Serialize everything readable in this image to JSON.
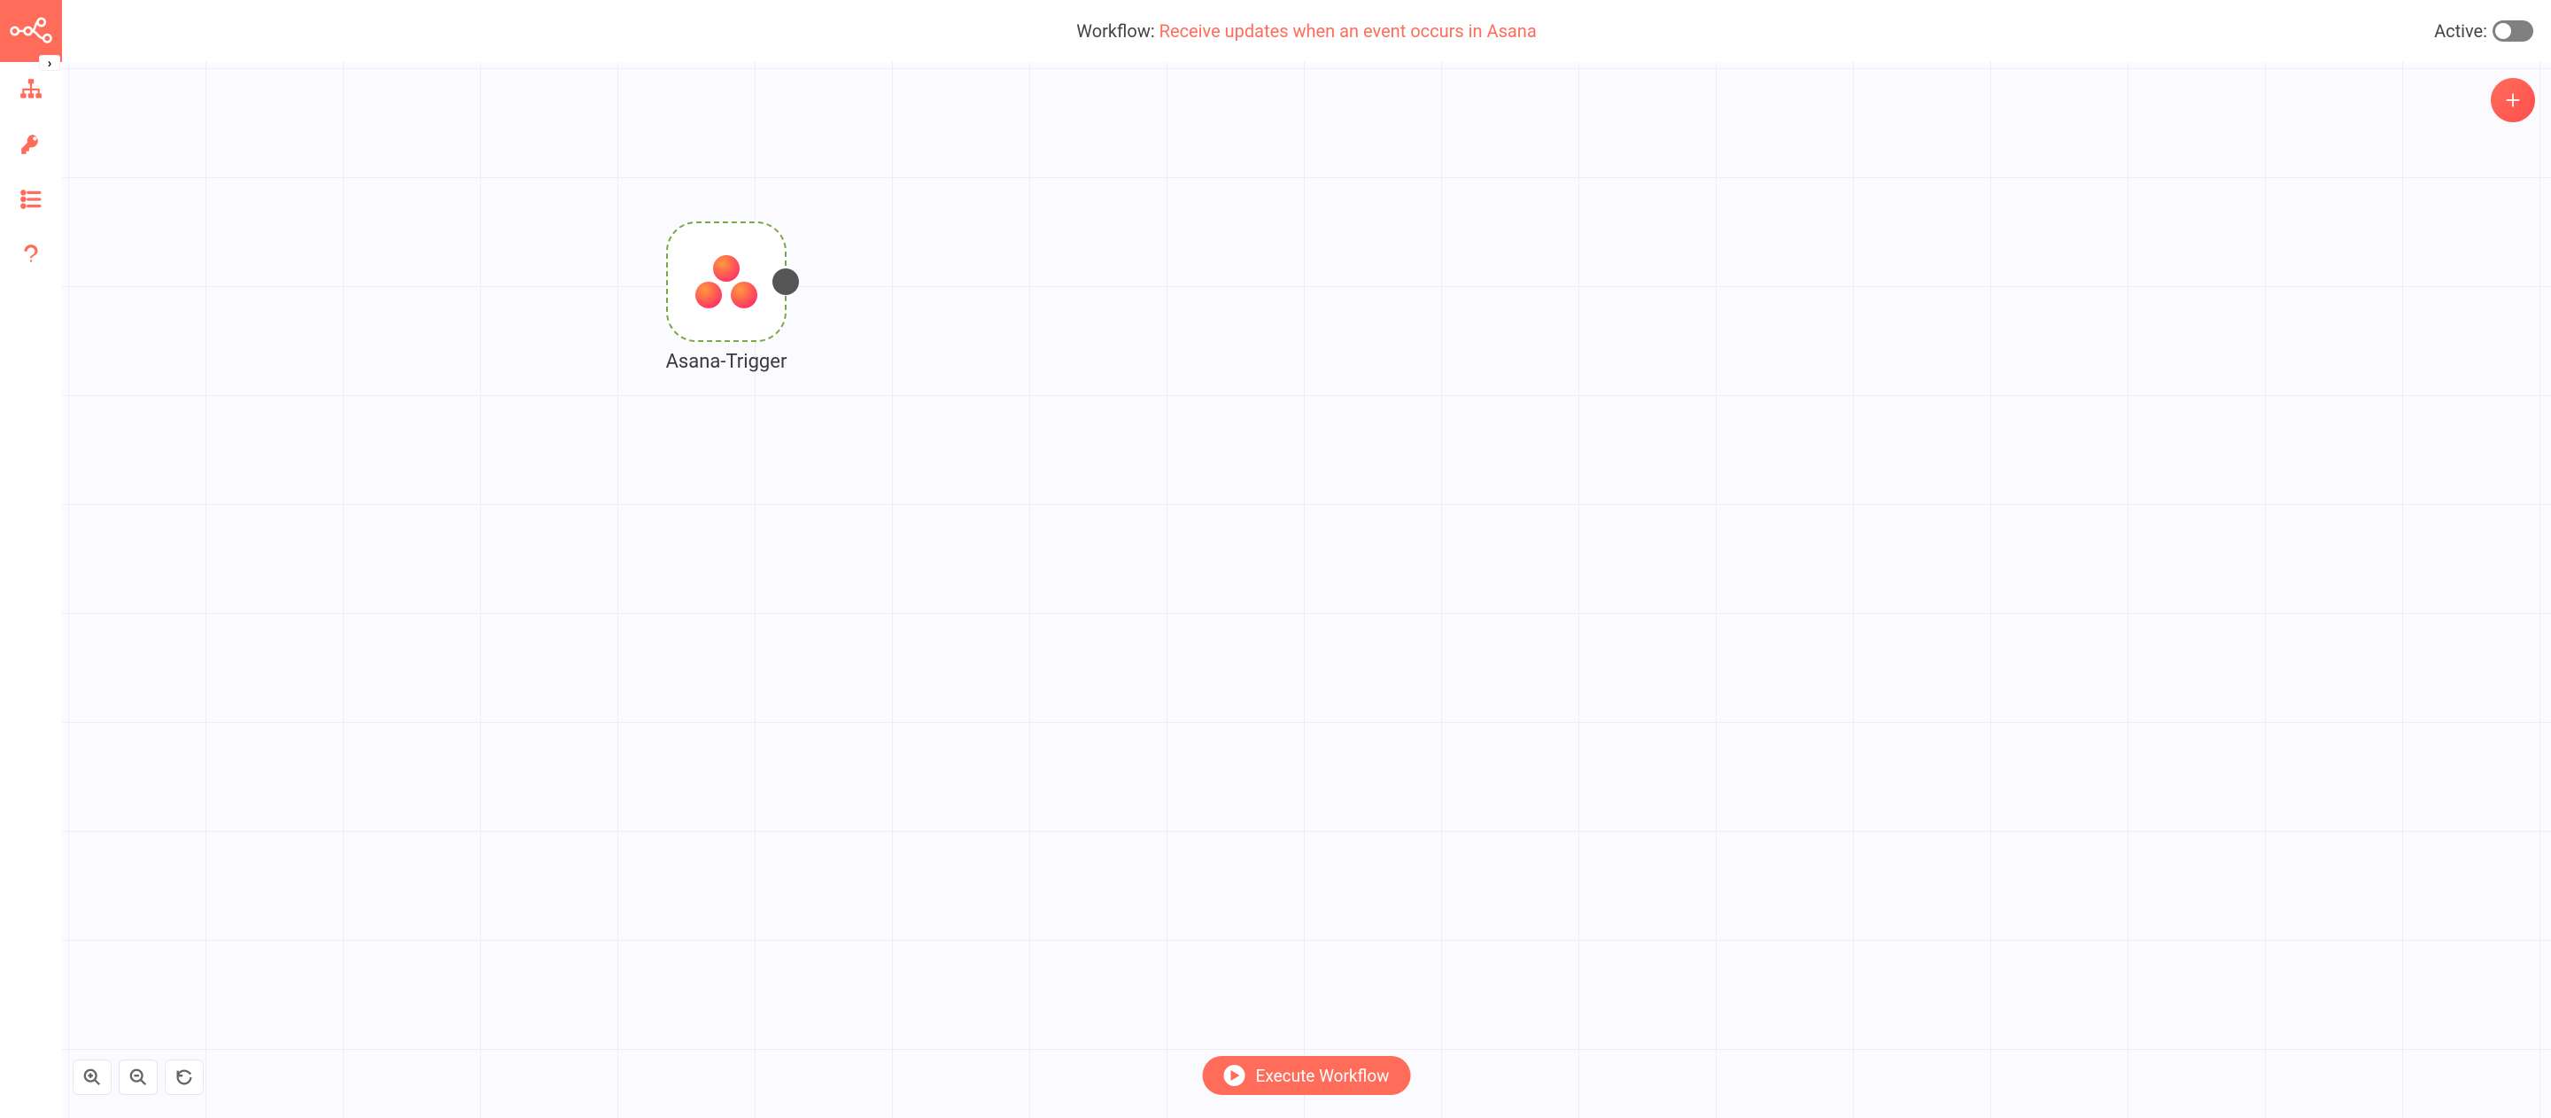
{
  "colors": {
    "accent": "#ff6d5a",
    "node_border": "#7aa845",
    "canvas_bg": "#fafaff"
  },
  "sidebar": {
    "logo_icon": "n8n-logo-icon",
    "expand_icon": "chevron-right-icon",
    "items": [
      {
        "name": "workflows",
        "icon": "sitemap-icon"
      },
      {
        "name": "credentials",
        "icon": "key-icon"
      },
      {
        "name": "executions",
        "icon": "list-icon"
      },
      {
        "name": "help",
        "icon": "question-icon"
      }
    ]
  },
  "header": {
    "prefix": "Workflow: ",
    "workflow_name": "Receive updates when an event occurs in Asana",
    "active_label": "Active:",
    "active_state": false
  },
  "canvas": {
    "add_node_icon": "plus-icon",
    "node": {
      "label": "Asana-Trigger",
      "app_icon": "asana-icon",
      "output_port": true,
      "selected": true
    },
    "zoom": {
      "in_icon": "zoom-in-icon",
      "out_icon": "zoom-out-icon",
      "reset_icon": "reset-icon"
    },
    "execute_label": "Execute Workflow"
  }
}
